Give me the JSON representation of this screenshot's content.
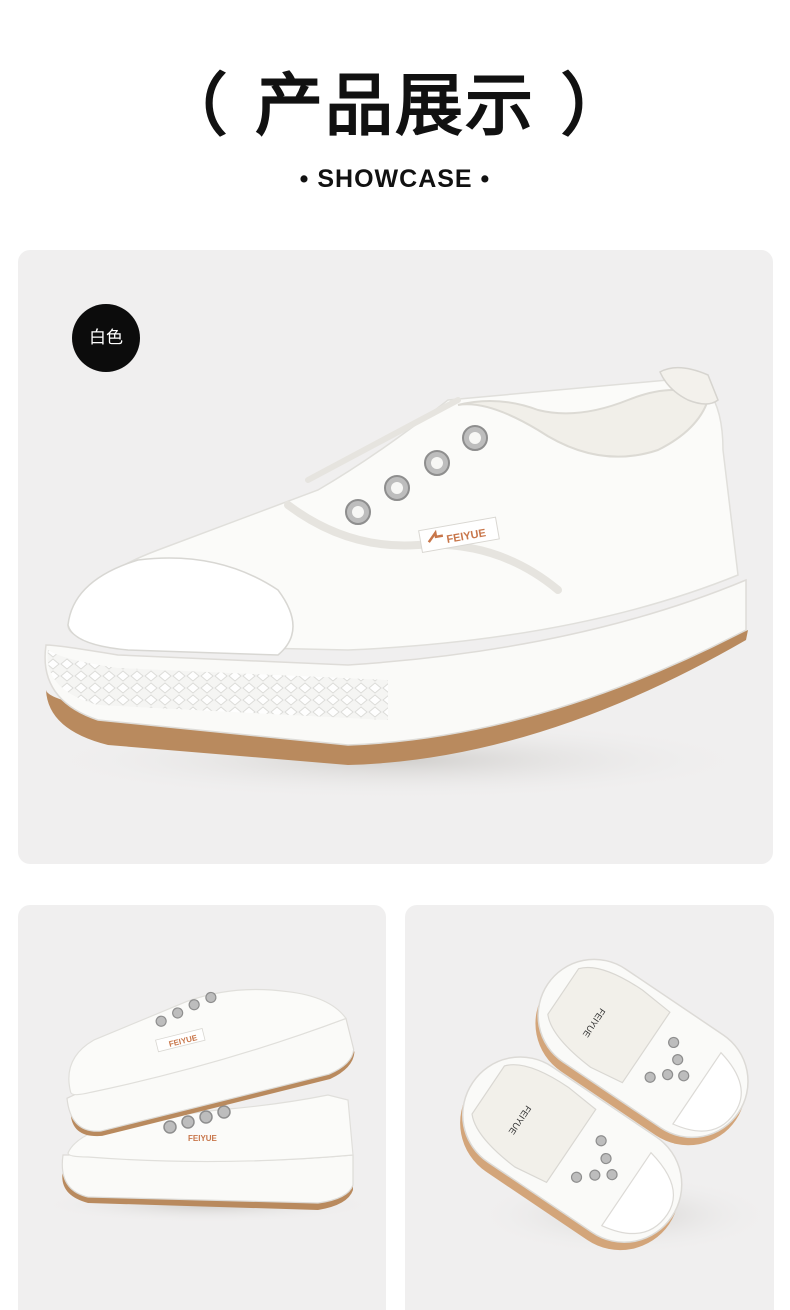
{
  "header": {
    "title": "（ 产品展示 ）",
    "subtitle": "• SHOWCASE •"
  },
  "main_panel": {
    "color_badge": "白色",
    "logo_text": "FEIYUE"
  },
  "left_panel": {
    "logo_text": "FEIYUE"
  },
  "right_panel": {
    "insole_text": "FEIYUE"
  },
  "colors": {
    "panel_bg": "#f0efef",
    "badge_bg": "#0c0c0c",
    "canvas": "#fafaf8",
    "sole_trim": "#b98a5e",
    "logo_accent": "#c8764a"
  }
}
